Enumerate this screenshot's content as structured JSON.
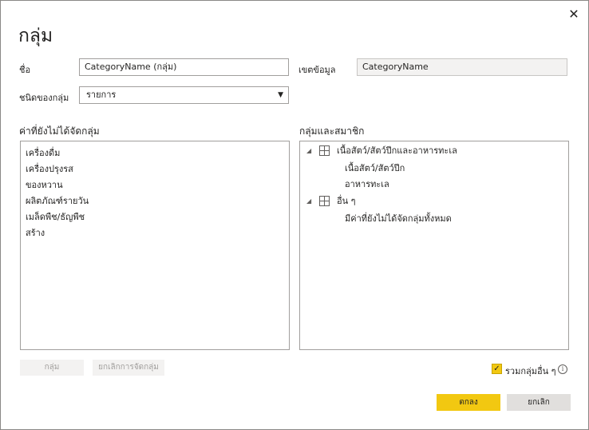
{
  "dialog": {
    "title": "กลุ่ม",
    "close_icon": "✕"
  },
  "form": {
    "name_label": "ชื่อ",
    "name_value": "CategoryName (กลุ่ม)",
    "field_label": "เขตข้อมูล",
    "field_value": "CategoryName",
    "group_type_label": "ชนิดของกลุ่ม",
    "group_type_value": "รายการ"
  },
  "ungrouped": {
    "title": "ค่าที่ยังไม่ได้จัดกลุ่ม",
    "items": [
      "เครื่องดื่ม",
      "เครื่องปรุงรส",
      "ของหวาน",
      "ผลิตภัณฑ์รายวัน",
      "เมล็ดพืช/ธัญพืช",
      "สร้าง"
    ]
  },
  "groups": {
    "title": "กลุ่มและสมาชิก",
    "tree": [
      {
        "label": "เนื้อสัตว์/สัตว์ปีกและอาหารทะเล",
        "members": [
          "เนื้อสัตว์/สัตว์ปีก",
          "อาหารทะเล"
        ]
      },
      {
        "label": "อื่น ๆ",
        "members": [
          "มีค่าที่ยังไม่ได้จัดกลุ่มทั้งหมด"
        ]
      }
    ]
  },
  "buttons": {
    "group": "กลุ่ม",
    "ungroup": "ยกเลิกการจัดกลุ่ม",
    "ok": "ตกลง",
    "cancel": "ยกเลิก"
  },
  "options": {
    "include_other_label": "รวมกลุ่มอื่น ๆ",
    "include_other_checked": true,
    "info_icon": "i"
  },
  "colors": {
    "accent": "#f2c811"
  }
}
